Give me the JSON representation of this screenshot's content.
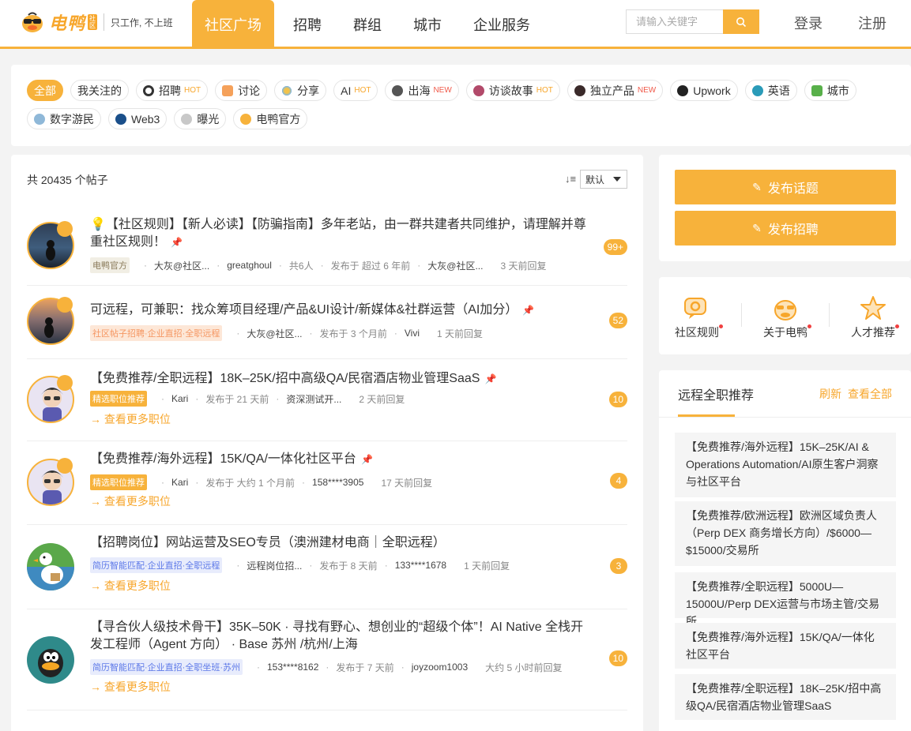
{
  "header": {
    "logo_text": "电鸭",
    "logo_badge": "社区",
    "slogan": "只工作, 不上班",
    "nav": [
      "社区广场",
      "招聘",
      "群组",
      "城市",
      "企业服务"
    ],
    "search_placeholder": "请输入关键字",
    "login": "登录",
    "register": "注册"
  },
  "tags": {
    "row1": [
      {
        "label": "全部",
        "flag": ""
      },
      {
        "label": "我关注的",
        "flag": ""
      },
      {
        "label": "招聘",
        "flag": "HOT"
      },
      {
        "label": "讨论",
        "flag": ""
      },
      {
        "label": "分享",
        "flag": ""
      },
      {
        "label": "AI",
        "flag": "HOT"
      },
      {
        "label": "出海",
        "flag": "NEW"
      },
      {
        "label": "访谈故事",
        "flag": "HOT"
      },
      {
        "label": "独立产品",
        "flag": "NEW"
      },
      {
        "label": "Upwork",
        "flag": ""
      },
      {
        "label": "英语",
        "flag": ""
      },
      {
        "label": "城市",
        "flag": ""
      }
    ],
    "row2": [
      {
        "label": "数字游民",
        "flag": ""
      },
      {
        "label": "Web3",
        "flag": ""
      },
      {
        "label": "曝光",
        "flag": ""
      },
      {
        "label": "电鸭官方",
        "flag": ""
      }
    ]
  },
  "posts_header": {
    "count_text": "共 20435 个帖子",
    "sort_icon": "↓≡",
    "sort_value": "默认"
  },
  "posts": [
    {
      "title": "💡【社区规则】【新人必读】【防骗指南】多年老站，由一群共建者共同维护，请理解并尊重社区规则！",
      "chip": "电鸭官方",
      "author": "大灰@社区...",
      "coauthor": "greatghoul",
      "coauthor_count": "共6人",
      "published": "发布于 超过 6 年前",
      "replier": "大灰@社区...",
      "replied": "3 天前回复",
      "count": "99+",
      "more_jobs": ""
    },
    {
      "title": "可远程，可兼职：找众筹项目经理/产品&UI设计/新媒体&社群运营（AI加分）",
      "chip": "社区帖子招聘·企业直招·全职远程",
      "author": "大灰@社区...",
      "published": "发布于 3 个月前",
      "replier": "Vivi",
      "replied": "1 天前回复",
      "count": "52",
      "more_jobs": ""
    },
    {
      "title": "【免费推荐/全职远程】18K–25K/招中高级QA/民宿酒店物业管理SaaS",
      "chip": "精选职位推荐",
      "author": "Kari",
      "published": "发布于 21 天前",
      "replier": "资深测试开...",
      "replied": "2 天前回复",
      "count": "10",
      "more_jobs": "→ 查看更多职位"
    },
    {
      "title": "【免费推荐/海外远程】15K/QA/一体化社区平台",
      "chip": "精选职位推荐",
      "author": "Kari",
      "published": "发布于 大约 1 个月前",
      "replier": "158****3905",
      "replied": "17 天前回复",
      "count": "4",
      "more_jobs": "→ 查看更多职位"
    },
    {
      "title": "【招聘岗位】网站运营及SEO专员（澳洲建材电商｜全职远程）",
      "chip": "简历智能匹配·企业直招·全职远程",
      "author": "远程岗位招...",
      "published": "发布于 8 天前",
      "replier": "133****1678",
      "replied": "1 天前回复",
      "count": "3",
      "more_jobs": "→ 查看更多职位"
    },
    {
      "title": "【寻合伙人级技术骨干】35K–50K · 寻找有野心、想创业的“超级个体”！AI Native 全栈开发工程师（Agent 方向） · Base 苏州 /杭州/上海",
      "chip": "简历智能匹配·企业直招·全职坐班·苏州",
      "author": "153****8162",
      "published": "发布于 7 天前",
      "replier": "joyzoom1003",
      "replied": "大约 5 小时前回复",
      "count": "10",
      "more_jobs": "→ 查看更多职位"
    }
  ],
  "publish": {
    "topic": "发布话题",
    "job": "发布招聘"
  },
  "quick_links": [
    "社区规则",
    "关于电鸭",
    "人才推荐"
  ],
  "recommend": {
    "title": "远程全职推荐",
    "refresh": "刷新",
    "view_all": "查看全部",
    "items": [
      "【免费推荐/海外远程】15K–25K/AI & Operations Automation/AI原生客户洞察与社区平台",
      "【免费推荐/欧洲远程】欧洲区域负责人（Perp DEX 商务增长方向）/$6000—$15000/交易所",
      "【免费推荐/全职远程】5000U—15000U/Perp DEX运营与市场主管/交易所",
      "【免费推荐/海外远程】15K/QA/一体化社区平台",
      "【免费推荐/全职远程】18K–25K/招中高级QA/民宿酒店物业管理SaaS"
    ]
  },
  "colors": {
    "accent": "#f7b23b",
    "accent_text": "#f7a62b",
    "new_flag": "#f05a4a"
  }
}
